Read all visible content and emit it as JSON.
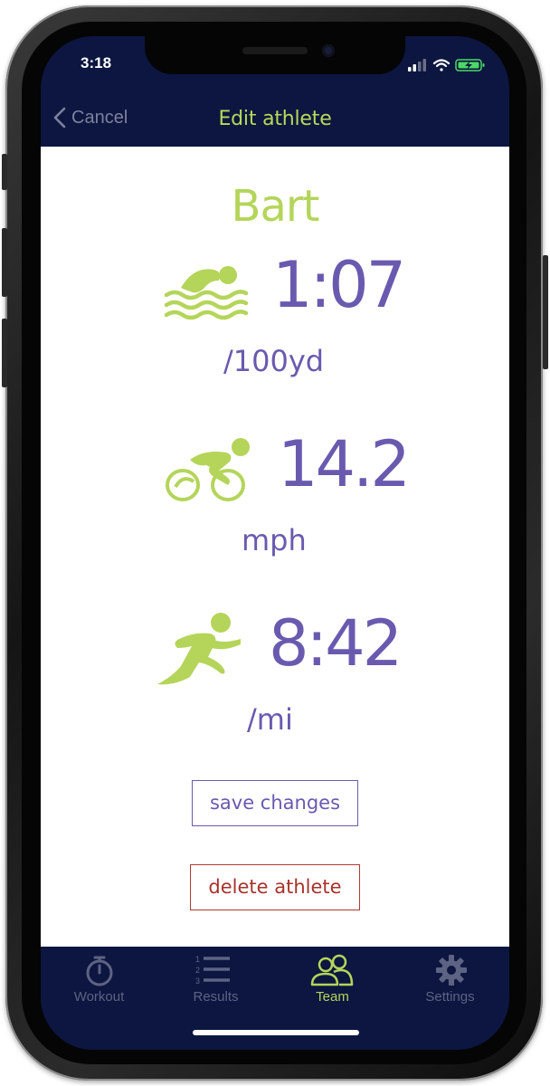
{
  "status": {
    "time": "3:18"
  },
  "nav": {
    "cancel_label": "Cancel",
    "title": "Edit athlete"
  },
  "athlete": {
    "name": "Bart",
    "swim": {
      "value": "1:07",
      "unit": "/100yd"
    },
    "bike": {
      "value": "14.2",
      "unit": "mph"
    },
    "run": {
      "value": "8:42",
      "unit": "/mi"
    }
  },
  "actions": {
    "save_label": "save changes",
    "delete_label": "delete athlete"
  },
  "tabs": [
    {
      "label": "Workout",
      "icon": "stopwatch-icon",
      "active": false
    },
    {
      "label": "Results",
      "icon": "numbered-list-icon",
      "active": false
    },
    {
      "label": "Team",
      "icon": "team-icon",
      "active": true
    },
    {
      "label": "Settings",
      "icon": "gear-icon",
      "active": false
    }
  ],
  "colors": {
    "navy": "#0c1640",
    "accent_green": "#b4d55a",
    "purple": "#6a5aaf",
    "delete_red": "#a8322c"
  }
}
